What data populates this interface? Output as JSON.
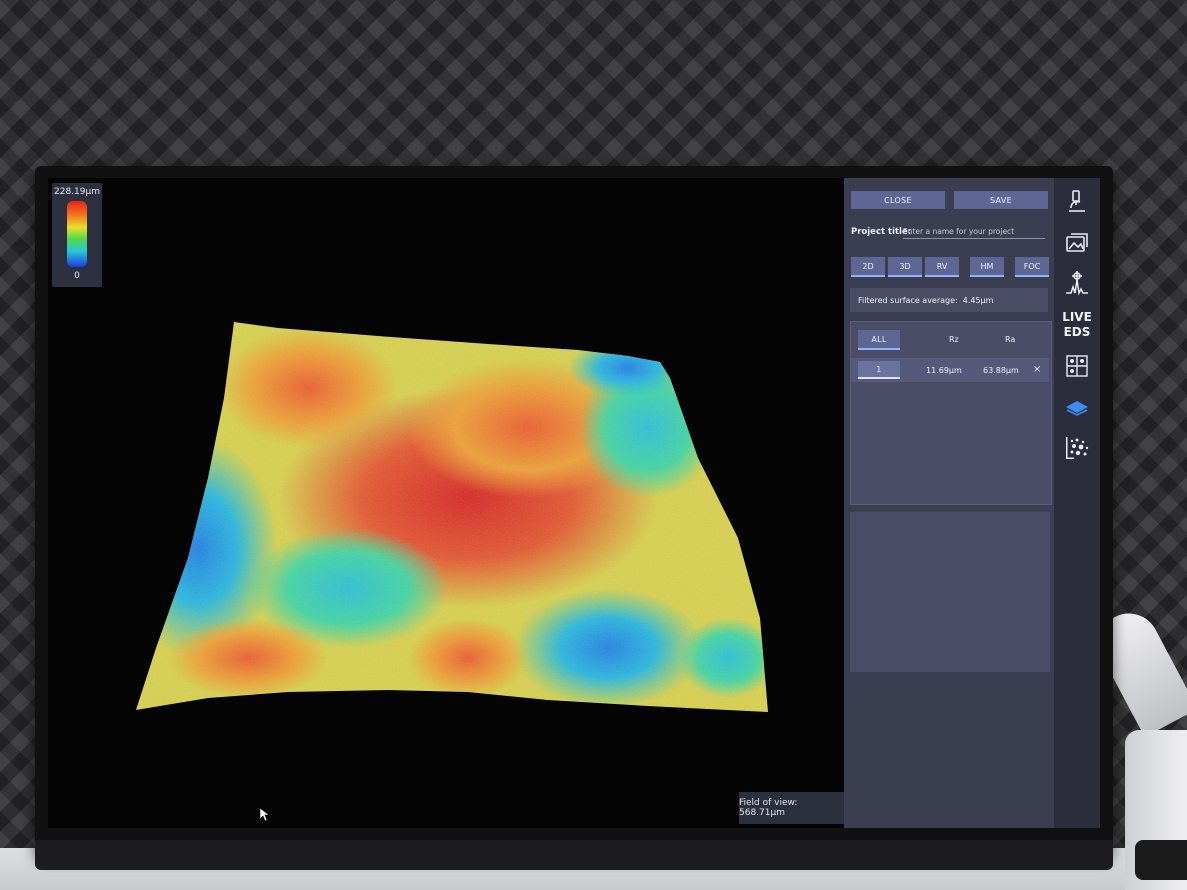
{
  "colors": {
    "panel_bg": "#3b3d51",
    "button_bg": "#5e6694",
    "accent_underline": "#8fb4ff",
    "rail_bg": "#2b2d3c",
    "icon_color": "#e8ebf6",
    "active_icon_color": "#3b8df0"
  },
  "legend": {
    "max_label": "228.19µm",
    "min_label": "0"
  },
  "toolbar": {
    "close_label": "CLOSE",
    "save_label": "SAVE"
  },
  "project": {
    "label": "Project title:",
    "placeholder": "Enter a name for your project"
  },
  "modes": [
    {
      "label": "2D"
    },
    {
      "label": "3D"
    },
    {
      "label": "RV"
    },
    {
      "label": "HM"
    },
    {
      "label": "FOC"
    }
  ],
  "filtered": {
    "label": "Filtered surface average:",
    "value": "4.45µm"
  },
  "table": {
    "all_label": "ALL",
    "columns": [
      "Rz",
      "Ra"
    ],
    "rows": [
      {
        "id": "1",
        "rz": "11.69µm",
        "ra": "63.88µm",
        "remove": "×"
      }
    ]
  },
  "view": {
    "fov_label": "Field of view: 568.71µm"
  },
  "rail": {
    "icons": [
      "microscope-icon",
      "gallery-icon",
      "spectrum-icon",
      "live-eds-label",
      "grid-icon",
      "layers-icon",
      "particles-icon"
    ],
    "live_line1": "LIVE",
    "live_line2": "EDS"
  }
}
